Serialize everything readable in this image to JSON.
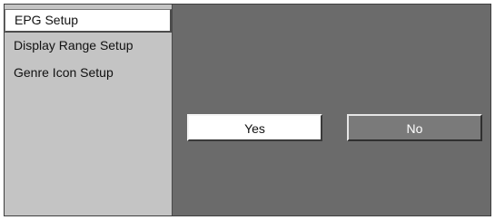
{
  "sidebar": {
    "items": [
      {
        "label": "EPG Setup",
        "selected": true
      },
      {
        "label": "Display Range Setup",
        "selected": false
      },
      {
        "label": "Genre Icon Setup",
        "selected": false
      }
    ]
  },
  "dialog": {
    "yes_label": "Yes",
    "no_label": "No"
  },
  "colors": {
    "sidebar_bg": "#c4c4c4",
    "main_bg": "#6b6b6b",
    "selected_bg": "#ffffff",
    "button_no_bg": "#7a7a7a"
  }
}
